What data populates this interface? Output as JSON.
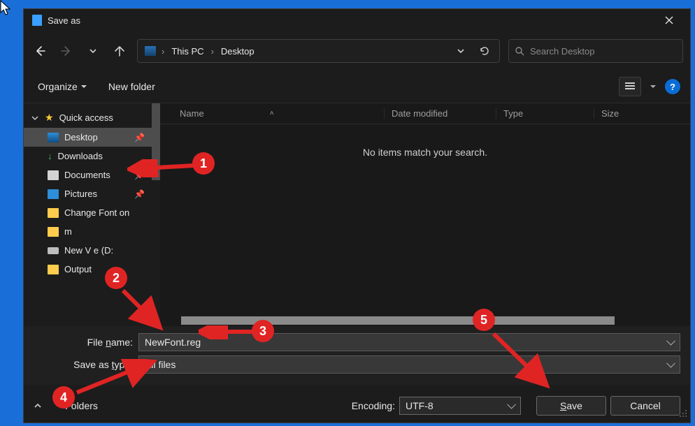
{
  "titlebar": {
    "title": "Save as"
  },
  "breadcrumbs": {
    "pc": "This PC",
    "folder": "Desktop"
  },
  "search": {
    "placeholder": "Search Desktop"
  },
  "toolbar": {
    "organize": "Organize",
    "newfolder": "New folder",
    "help": "?"
  },
  "columns": {
    "name": "Name",
    "date": "Date modified",
    "type": "Type",
    "size": "Size"
  },
  "empty": "No items match your search.",
  "sidebar": {
    "quick": "Quick access",
    "items": [
      {
        "label": "Desktop"
      },
      {
        "label": "Downloads"
      },
      {
        "label": "Documents"
      },
      {
        "label": "Pictures"
      },
      {
        "label": "Change Font on"
      },
      {
        "label": "m"
      },
      {
        "label": "New V           e (D:"
      },
      {
        "label": "Output"
      }
    ]
  },
  "form": {
    "filename_label_pre": "File ",
    "filename_label_u": "n",
    "filename_label_post": "ame:",
    "filename_value": "NewFont.reg",
    "saveastype_label_pre": "Save as ",
    "saveastype_label_u": "t",
    "saveastype_label_post": "ype:",
    "saveastype_value": "All files"
  },
  "bottom": {
    "browse": "       Folders",
    "encoding_label": "Encoding:",
    "encoding_value": "UTF-8",
    "save_pre": "",
    "save_u": "S",
    "save_post": "ave",
    "cancel": "Cancel"
  },
  "annotations": {
    "a1": "1",
    "a2": "2",
    "a3": "3",
    "a4": "4",
    "a5": "5"
  }
}
